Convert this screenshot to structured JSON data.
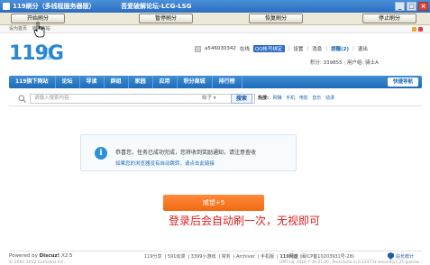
{
  "window": {
    "title": "119刷分（多线程服务器版）",
    "site": "吾爱破解论坛-LCG-LSG",
    "controls": [
      "_",
      "□",
      "×"
    ]
  },
  "toolbar": {
    "buttons": [
      "开始刷分",
      "暂停刷分",
      "恢复刷分",
      "停止刷分"
    ]
  },
  "topbar": {
    "links": [
      "设为首页",
      "收藏本站"
    ]
  },
  "logo": {
    "main": "119G",
    "sub": "网盘",
    "sub2": ".com"
  },
  "user": {
    "name": "a546030342",
    "status": "在线",
    "qq": "QQ帐号绑定",
    "links": [
      "设置",
      "消息"
    ],
    "remind": "提醒(2)",
    "logout": "退出",
    "points": "积分: 339855",
    "group": "用户组: 骑士A"
  },
  "nav": {
    "items": [
      "119旗下网站",
      "论坛",
      "导读",
      "群组",
      "家园",
      "应用",
      "积分商城",
      "排行榜"
    ],
    "quick": "快捷导航"
  },
  "search": {
    "placeholder": "请输入搜索内容",
    "select": "帖子",
    "button": "搜索",
    "hot_label": "热搜:",
    "hot": [
      "网赚",
      "手机",
      "电影",
      "音乐",
      "动漫"
    ]
  },
  "message": {
    "line1": "恭喜您，任务已成功完成，您将收到奖励通知，请注意查收",
    "line2": "如果您的浏览器没有自动跳转，请点击此链接"
  },
  "sign": {
    "button": "威望+5"
  },
  "notice": "登录后会自动刷一次，无视即可",
  "footer": {
    "powered": "Powered by",
    "brand": "Discuz!",
    "version": "X2.5",
    "copyright": "© 2001-2012 Comsenz Inc.",
    "links": [
      "119分享",
      "591动漫",
      "3399小游戏",
      "常务",
      "Archiver",
      "手机版",
      "119网盘",
      "(闽ICP备10203931号-28)"
    ],
    "gmt": "GMT+8, 2016-7-30 01:20 , Processed in 0.124733 second(s), 25 queries .",
    "badge": "站长统计"
  }
}
